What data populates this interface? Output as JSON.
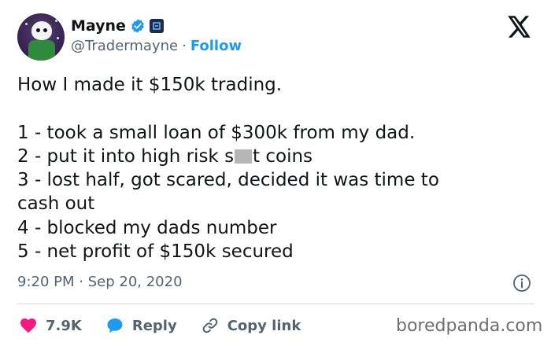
{
  "author": {
    "name": "Mayne",
    "handle": "@Tradermayne",
    "separator": "·",
    "follow_label": "Follow"
  },
  "tweet": {
    "lines": [
      "How I made it $150k trading.",
      "",
      "1 - took a small loan of $300k from my dad.",
      "2 - put it into high risk s",
      "t coins",
      "3 - lost half, got scared, decided it was time to",
      "cash out",
      "4 - blocked my dads number",
      "5 - net profit of $150k secured"
    ]
  },
  "meta": {
    "time": "9:20 PM",
    "date": "Sep 20, 2020",
    "separator": "·"
  },
  "actions": {
    "likes": "7.9K",
    "reply_label": "Reply",
    "copy_link_label": "Copy link"
  },
  "watermark": "boredpanda.com",
  "colors": {
    "accent": "#1d9bf0",
    "like": "#f91880",
    "text": "#0f1419",
    "muted": "#536471"
  },
  "icons": [
    "verified-badge-icon",
    "affiliate-badge-icon",
    "x-logo-icon",
    "info-icon",
    "heart-icon",
    "reply-icon",
    "link-icon"
  ]
}
